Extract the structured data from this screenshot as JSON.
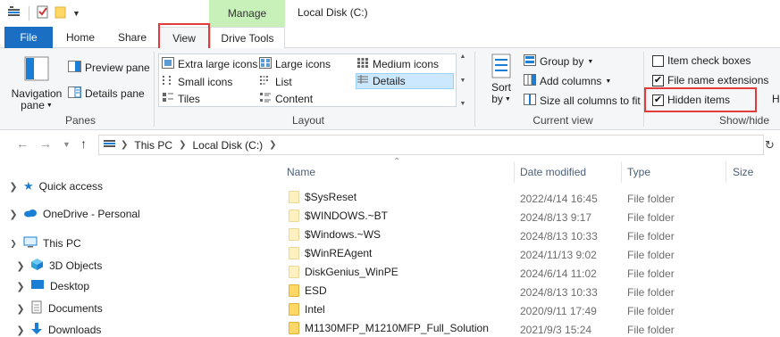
{
  "window": {
    "title": "Local Disk (C:)",
    "contextual_tab": "Manage"
  },
  "tabs": {
    "file": "File",
    "home": "Home",
    "share": "Share",
    "view": "View",
    "drive_tools": "Drive Tools"
  },
  "ribbon": {
    "panes": {
      "navigation_pane_line1": "Navigation",
      "navigation_pane_line2": "pane",
      "preview_pane": "Preview pane",
      "details_pane": "Details pane",
      "label": "Panes"
    },
    "layout": {
      "items": [
        "Extra large icons",
        "Large icons",
        "Medium icons",
        "Small icons",
        "List",
        "Details",
        "Tiles",
        "Content"
      ],
      "selected": "Details",
      "label": "Layout"
    },
    "current_view": {
      "sort_line1": "Sort",
      "sort_line2": "by",
      "group_by": "Group by",
      "add_columns": "Add columns",
      "size_all_columns": "Size all columns to fit",
      "label": "Current view"
    },
    "show_hide": {
      "item_check_boxes": "Item check boxes",
      "item_check_boxes_checked": false,
      "file_name_extensions": "File name extensions",
      "file_name_extensions_checked": true,
      "hidden_items": "Hidden items",
      "hidden_items_checked": true,
      "label": "Show/hide",
      "overflow_label": "H"
    }
  },
  "address": {
    "crumbs": [
      "This PC",
      "Local Disk (C:)"
    ]
  },
  "nav": {
    "items": [
      {
        "label": "Quick access",
        "icon": "star-icon"
      },
      {
        "label": "OneDrive - Personal",
        "icon": "cloud-icon"
      },
      {
        "label": "This PC",
        "icon": "computer-icon"
      },
      {
        "label": "3D Objects",
        "icon": "cube-icon"
      },
      {
        "label": "Desktop",
        "icon": "desktop-icon"
      },
      {
        "label": "Documents",
        "icon": "document-icon"
      },
      {
        "label": "Downloads",
        "icon": "download-icon"
      }
    ]
  },
  "files": {
    "columns": {
      "name": "Name",
      "date": "Date modified",
      "type": "Type",
      "size": "Size"
    },
    "rows": [
      {
        "name": "$SysReset",
        "date": "2022/4/14 16:45",
        "type": "File folder",
        "hidden": true
      },
      {
        "name": "$WINDOWS.~BT",
        "date": "2024/8/13 9:17",
        "type": "File folder",
        "hidden": true
      },
      {
        "name": "$Windows.~WS",
        "date": "2024/8/13 10:33",
        "type": "File folder",
        "hidden": true
      },
      {
        "name": "$WinREAgent",
        "date": "2024/11/13 9:02",
        "type": "File folder",
        "hidden": true
      },
      {
        "name": "DiskGenius_WinPE",
        "date": "2024/6/14 11:02",
        "type": "File folder",
        "hidden": true
      },
      {
        "name": "ESD",
        "date": "2024/8/13 10:33",
        "type": "File folder",
        "hidden": false
      },
      {
        "name": "Intel",
        "date": "2020/9/11 17:49",
        "type": "File folder",
        "hidden": false
      },
      {
        "name": "M1130MFP_M1210MFP_Full_Solution",
        "date": "2021/9/3 15:24",
        "type": "File folder",
        "hidden": false
      }
    ]
  },
  "colors": {
    "file_tab": "#1a6fc4",
    "manage_tab": "#c7f1b8",
    "highlight_box": "#e33b3b",
    "selected_layout": "#cce8ff"
  }
}
